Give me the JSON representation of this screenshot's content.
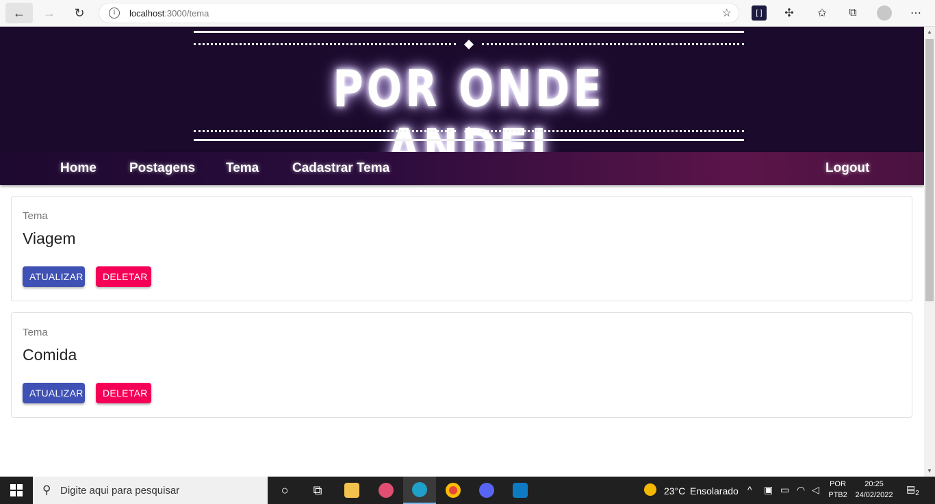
{
  "browser": {
    "url_host": "localhost",
    "url_path": ":3000/tema"
  },
  "banner": {
    "title": "POR ONDE ANDEI"
  },
  "nav": {
    "items": [
      "Home",
      "Postagens",
      "Tema",
      "Cadastrar Tema"
    ],
    "logout": "Logout"
  },
  "cards": [
    {
      "label": "Tema",
      "name": "Viagem",
      "update_label": "ATUALIZAR",
      "delete_label": "DELETAR"
    },
    {
      "label": "Tema",
      "name": "Comida",
      "update_label": "ATUALIZAR",
      "delete_label": "DELETAR"
    }
  ],
  "taskbar": {
    "search_placeholder": "Digite aqui para pesquisar",
    "weather_temp": "23°C",
    "weather_text": "Ensolarado",
    "lang_top": "POR",
    "lang_bottom": "PTB2",
    "time": "20:25",
    "date": "24/02/2022",
    "notification_count": "2"
  },
  "colors": {
    "update_button": "#3f51b5",
    "delete_button": "#f50057",
    "banner_bg": "#1b0a2c"
  }
}
